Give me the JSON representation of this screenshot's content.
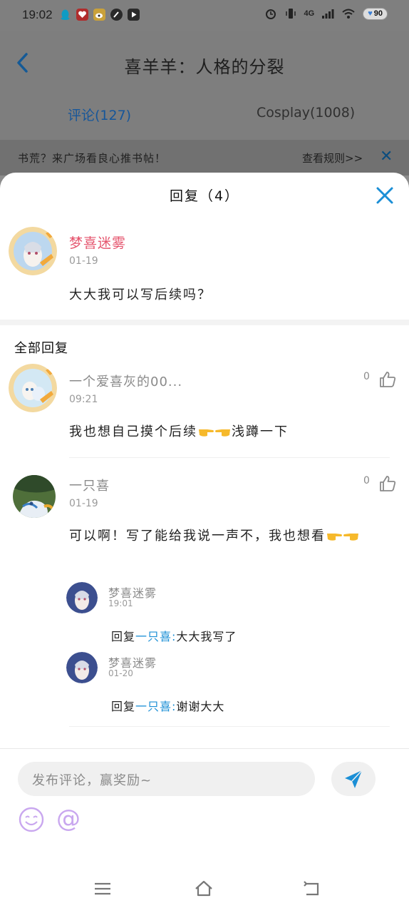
{
  "status_bar": {
    "time": "19:02",
    "network": "4G",
    "battery": "90"
  },
  "background_page": {
    "title": "喜羊羊：人格的分裂",
    "tabs": [
      {
        "label": "评论(127)",
        "active": true
      },
      {
        "label": "Cosplay(1008)",
        "active": false
      }
    ],
    "banner_text": "书荒？来广场看良心推书帖！",
    "banner_link": "查看规则>>"
  },
  "sheet": {
    "title": "回复（4）",
    "main_comment": {
      "author": "梦喜迷雾",
      "date": "01-19",
      "text": "大大我可以写后续吗？"
    },
    "section_title": "全部回复",
    "replies": [
      {
        "name": "一个爱喜灰的00...",
        "date": "09:21",
        "likes": "0",
        "text_before": "我也想自己摸个后续",
        "text_after": "浅蹲一下"
      },
      {
        "name": "一只喜",
        "date": "01-19",
        "likes": "0",
        "text": "可以啊！写了能给我说一声不，我也想看",
        "sub_replies": [
          {
            "name": "梦喜迷雾",
            "date": "19:01",
            "prefix": "回复",
            "mention": "一只喜:",
            "text": "大大我写了"
          },
          {
            "name": "梦喜迷雾",
            "date": "01-20",
            "prefix": "回复",
            "mention": "一只喜:",
            "text": "谢谢大大"
          }
        ]
      }
    ]
  },
  "input": {
    "placeholder": "发布评论，赢奖励~"
  },
  "colors": {
    "accent": "#1b8fd6",
    "author_pink": "#e5546d",
    "background_dim": "#8c8c8c"
  }
}
